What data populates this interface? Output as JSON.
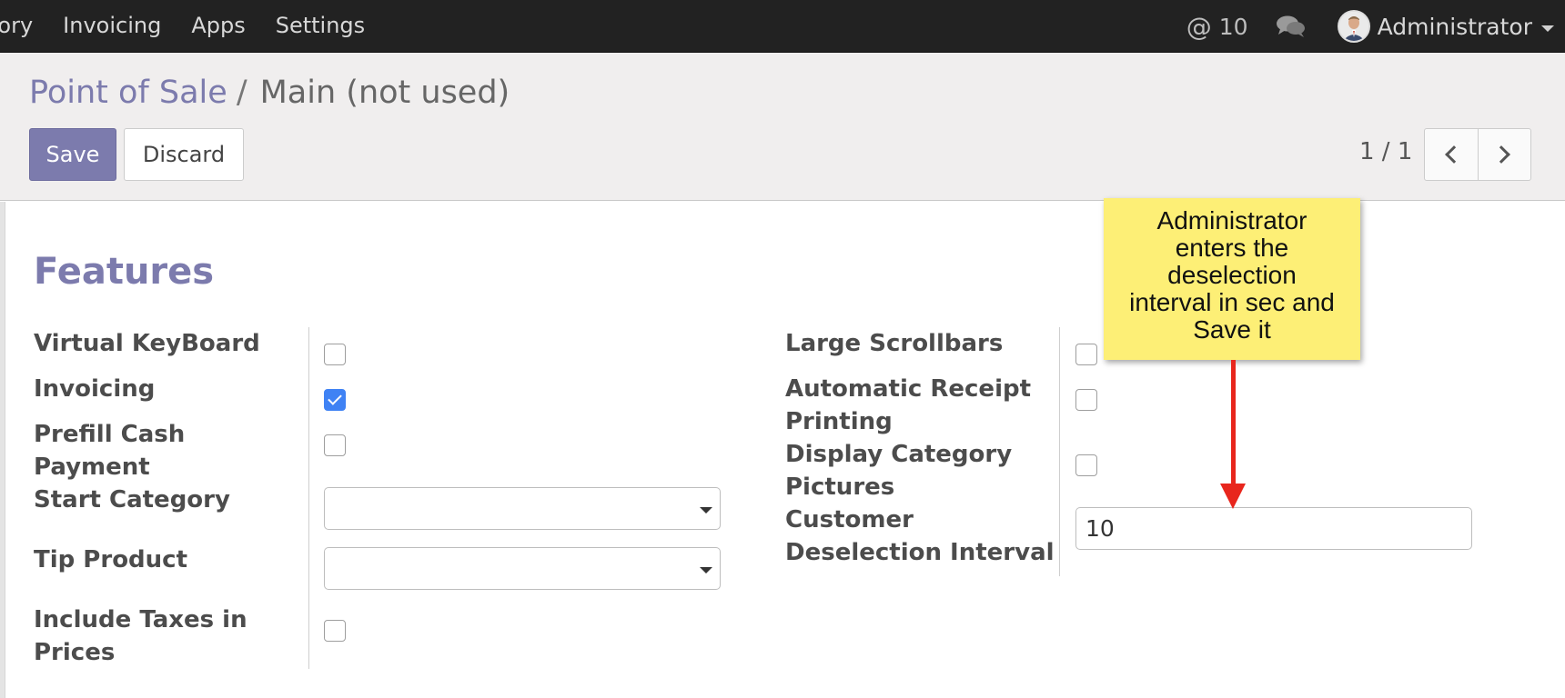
{
  "navbar": {
    "menu": [
      "tory",
      "Invoicing",
      "Apps",
      "Settings"
    ],
    "mentions_count": "10",
    "user_name": "Administrator"
  },
  "breadcrumb": {
    "parent": "Point of Sale",
    "separator": "/",
    "current": "Main (not used)"
  },
  "toolbar": {
    "save_label": "Save",
    "discard_label": "Discard"
  },
  "pager": {
    "value": "1 / 1"
  },
  "section": {
    "title": "Features"
  },
  "left_fields": [
    {
      "label": "Virtual KeyBoard",
      "type": "checkbox",
      "checked": false
    },
    {
      "label": "Invoicing",
      "type": "checkbox",
      "checked": true
    },
    {
      "label": "Prefill Cash Payment",
      "line1": "Prefill Cash",
      "line2": "Payment",
      "type": "checkbox",
      "checked": false
    },
    {
      "label": "Start Category",
      "type": "select",
      "value": ""
    },
    {
      "label": "Tip Product",
      "type": "select",
      "value": ""
    },
    {
      "label": "Include Taxes in Prices",
      "line1": "Include Taxes in",
      "line2": "Prices",
      "type": "checkbox",
      "checked": false
    }
  ],
  "right_fields": [
    {
      "label": "Large Scrollbars",
      "type": "checkbox",
      "checked": false
    },
    {
      "label": "Automatic Receipt Printing",
      "line1": "Automatic Receipt",
      "line2": "Printing",
      "type": "checkbox",
      "checked": false
    },
    {
      "label": "Display Category Pictures",
      "line1": "Display Category",
      "line2": "Pictures",
      "type": "checkbox",
      "checked": false
    },
    {
      "label": "Customer Deselection Interval",
      "line1": "Customer",
      "line2": "Deselection Interval",
      "type": "integer",
      "value": "10"
    }
  ],
  "annotation": {
    "line1": "Administrator",
    "line2": "enters the",
    "line3": "deselection",
    "line4": "interval in sec and",
    "line5": "Save it",
    "color": "#fdef76",
    "arrow_color": "#e8261d"
  },
  "colors": {
    "navbar": "#222222",
    "brand": "#7c7bad",
    "checkbox_checked": "#3f82f4"
  }
}
